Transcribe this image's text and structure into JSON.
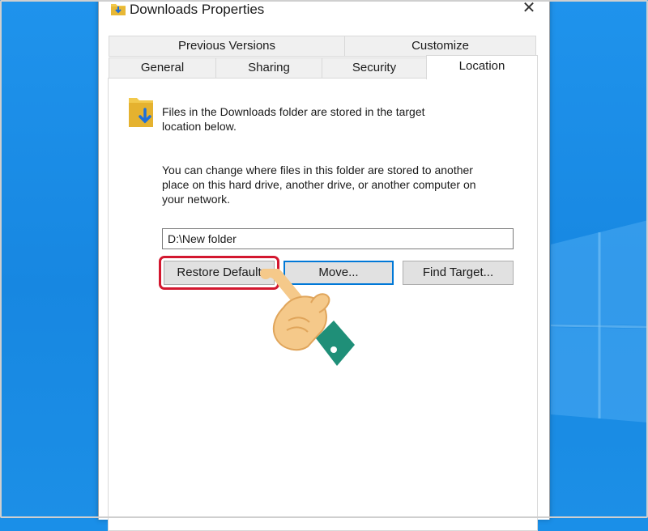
{
  "window": {
    "title": "Downloads Properties",
    "close_glyph": "✕"
  },
  "tabs": {
    "row1": [
      "Previous Versions",
      "Customize"
    ],
    "row2": [
      "General",
      "Sharing",
      "Security",
      "Location"
    ],
    "active": "Location"
  },
  "location": {
    "info_line1": "Files in the Downloads folder are stored in the target",
    "info_line2": "location below.",
    "desc_line1": "You can change where files in this folder are stored to another",
    "desc_line2": "place on this hard drive, another drive, or another computer on",
    "desc_line3": "your network.",
    "path_value": "D:\\New folder"
  },
  "buttons": {
    "restore_default": "Restore Default",
    "move": "Move...",
    "find_target": "Find Target..."
  },
  "icons": {
    "title": "downloads-folder-icon",
    "folder": "downloads-folder-icon",
    "pointer": "pointing-hand-icon",
    "desktop": "windows-logo"
  },
  "colors": {
    "highlight": "#d3172f",
    "desktop_blue": "#1a8fe8",
    "default_button_border": "#0078d7"
  }
}
